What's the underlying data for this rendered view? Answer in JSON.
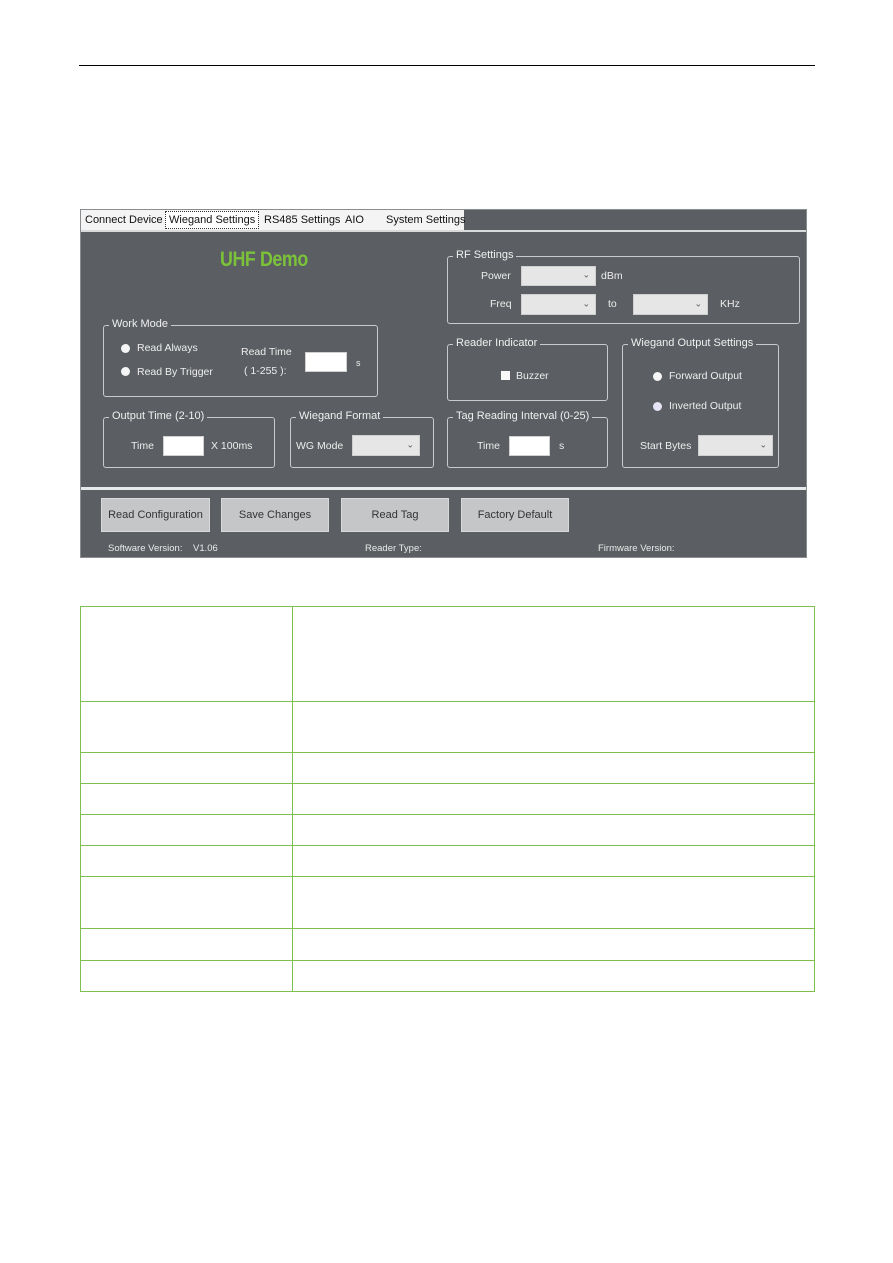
{
  "app": {
    "tabs": [
      {
        "label": "Connect Device",
        "active": false
      },
      {
        "label": "Wiegand Settings",
        "active": true
      },
      {
        "label": "RS485 Settings",
        "active": false
      },
      {
        "label": "AIO",
        "active": false
      },
      {
        "label": "System Settings",
        "active": false
      }
    ],
    "title": "UHF Demo",
    "title_color": "#7bc23a",
    "rf_settings": {
      "legend": "RF Settings",
      "power_label": "Power",
      "power_value": "",
      "power_unit": "dBm",
      "freq_label": "Freq",
      "freq_from_value": "",
      "freq_to_label": "to",
      "freq_to_value": "",
      "freq_unit": "KHz"
    },
    "work_mode": {
      "legend": "Work Mode",
      "option_read_always": "Read Always",
      "option_read_by_trigger": "Read By Trigger",
      "read_time_label_1": "Read Time",
      "read_time_label_2": "( 1-255 ):",
      "read_time_value": "",
      "read_time_unit": "s"
    },
    "reader_indicator": {
      "legend": "Reader Indicator",
      "buzzer_label": "Buzzer",
      "buzzer_checked": false
    },
    "wiegand_output": {
      "legend": "Wiegand Output Settings",
      "forward_label": "Forward Output",
      "inverted_label": "Inverted Output",
      "start_bytes_label": "Start Bytes",
      "start_bytes_value": ""
    },
    "output_time": {
      "legend": "Output Time (2-10)",
      "time_label": "Time",
      "time_value": "",
      "unit": "X 100ms"
    },
    "wiegand_format": {
      "legend": "Wiegand Format",
      "wg_mode_label": "WG Mode",
      "wg_mode_value": ""
    },
    "tag_interval": {
      "legend": "Tag Reading Interval (0-25)",
      "time_label": "Time",
      "time_value": "",
      "unit": "s"
    },
    "buttons": {
      "read_configuration": "Read Configuration",
      "save_changes": "Save Changes",
      "read_tag": "Read Tag",
      "factory_default": "Factory Default"
    },
    "status": {
      "software_version_label": "Software Version:",
      "software_version_value": "V1.06",
      "reader_type_label": "Reader Type:",
      "reader_type_value": "",
      "firmware_version_label": "Firmware Version:",
      "firmware_version_value": ""
    }
  },
  "table": {
    "rows": [
      [
        "",
        ""
      ],
      [
        "",
        ""
      ],
      [
        "",
        ""
      ],
      [
        "",
        ""
      ],
      [
        "",
        ""
      ],
      [
        "",
        ""
      ],
      [
        "",
        ""
      ],
      [
        "",
        ""
      ],
      [
        "",
        ""
      ]
    ]
  }
}
